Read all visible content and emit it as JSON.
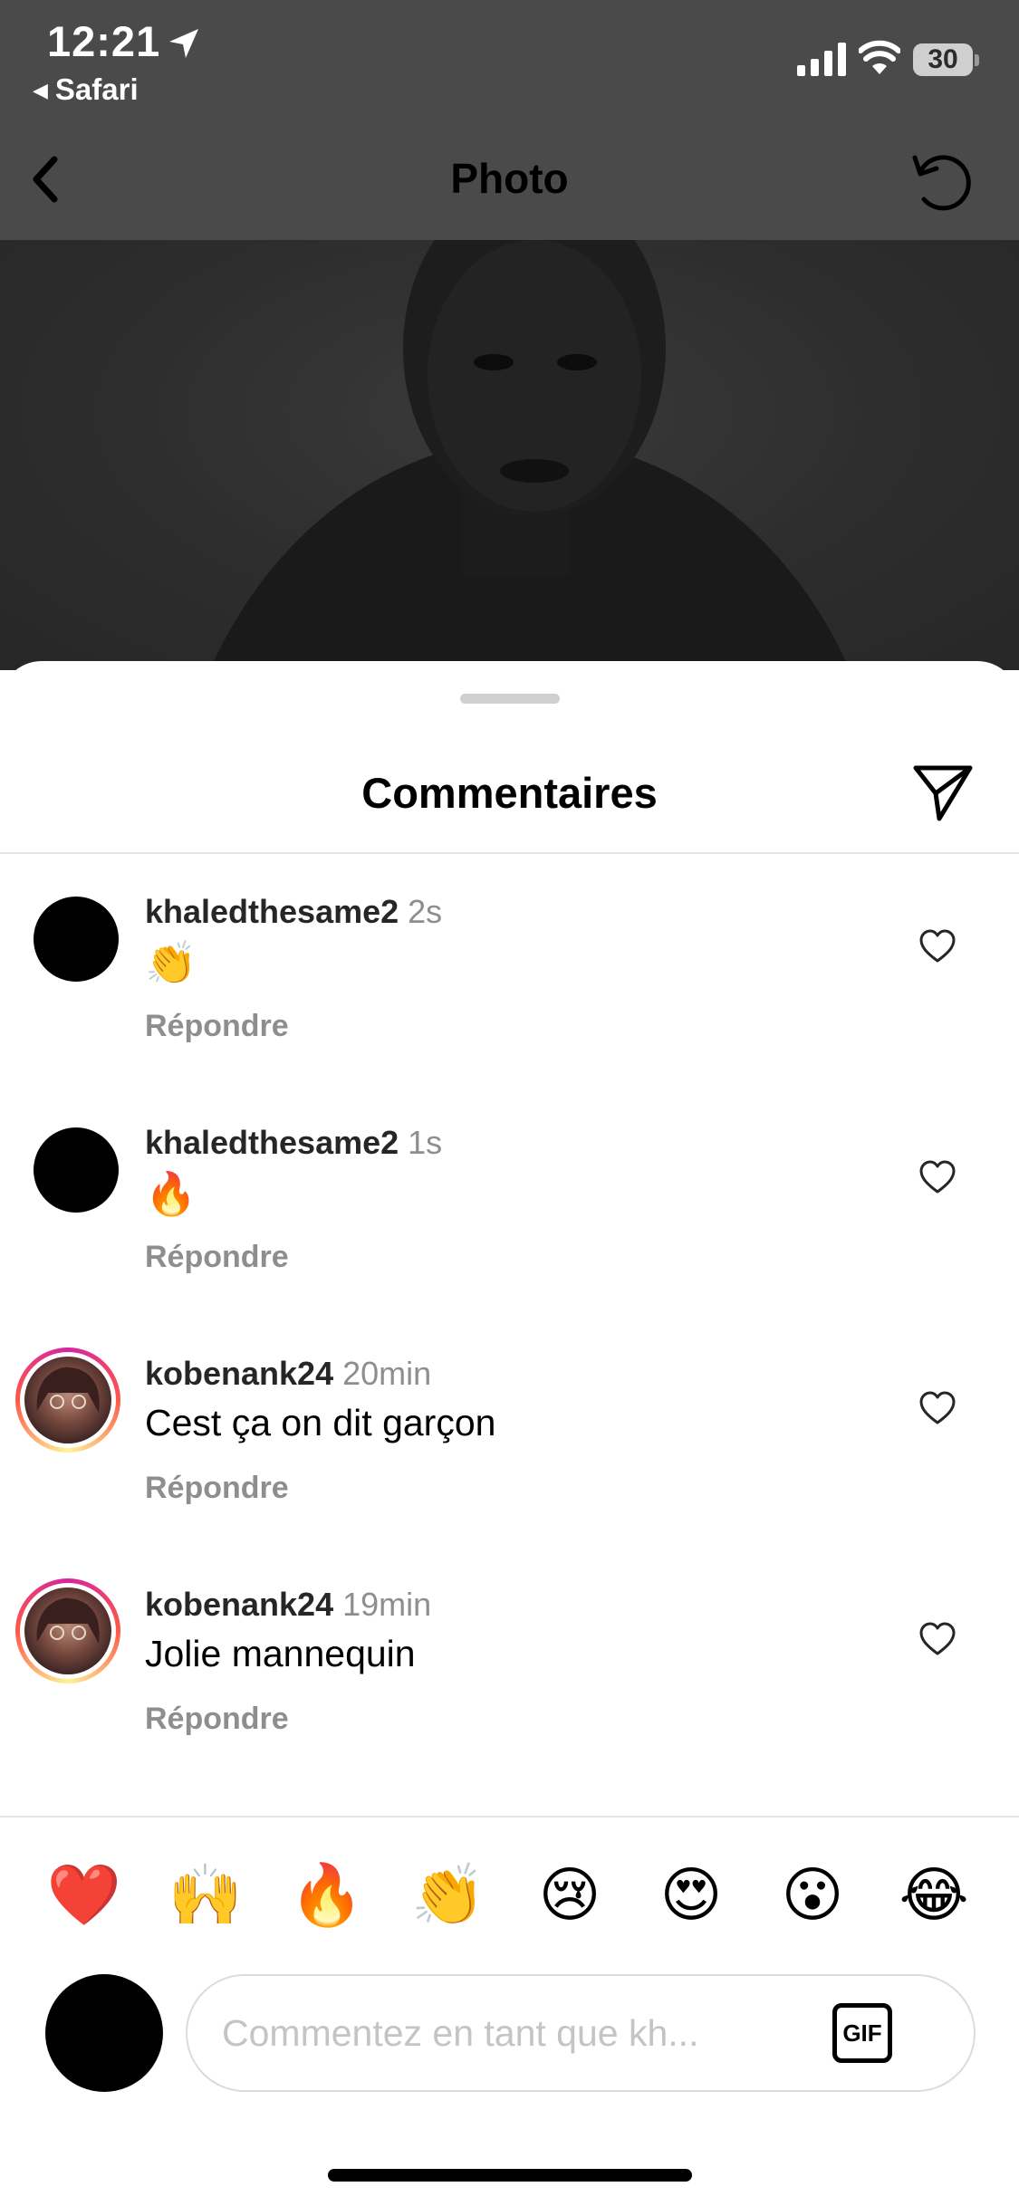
{
  "status_bar": {
    "time": "12:21",
    "back_app": "Safari",
    "battery": "30"
  },
  "nav": {
    "title": "Photo"
  },
  "sheet": {
    "title": "Commentaires"
  },
  "comments": [
    {
      "username": "khaledthesame2",
      "time": "2s",
      "text": "👏",
      "reply_label": "Répondre"
    },
    {
      "username": "khaledthesame2",
      "time": "1s",
      "text": "🔥",
      "reply_label": "Répondre"
    },
    {
      "username": "kobenank24",
      "time": "20min",
      "text": "Cest ça on dit garçon",
      "reply_label": "Répondre"
    },
    {
      "username": "kobenank24",
      "time": "19min",
      "text": "Jolie mannequin",
      "reply_label": "Répondre"
    }
  ],
  "quick_reactions": [
    "❤️",
    "🙌",
    "🔥",
    "👏",
    "😢",
    "😍",
    "😮",
    "😂"
  ],
  "composer": {
    "placeholder": "Commentez en tant que kh...",
    "gif_label": "GIF"
  }
}
